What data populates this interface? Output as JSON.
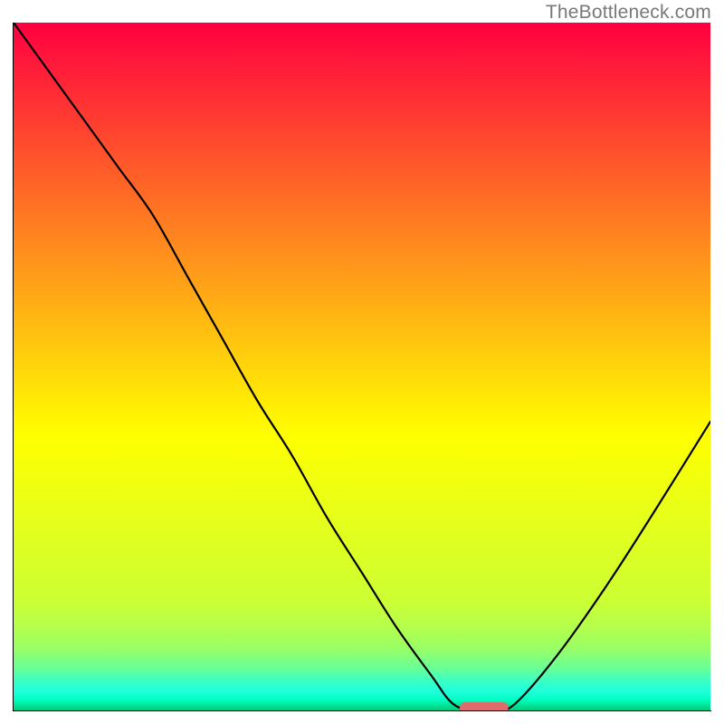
{
  "watermark": "TheBottleneck.com",
  "chart_data": {
    "type": "line",
    "title": "",
    "xlabel": "",
    "ylabel": "",
    "xlim": [
      0,
      100
    ],
    "ylim": [
      0,
      100
    ],
    "x": [
      0,
      5,
      10,
      15,
      20,
      25,
      30,
      35,
      40,
      45,
      50,
      55,
      60,
      63,
      66,
      69,
      72,
      78,
      85,
      92,
      100
    ],
    "y": [
      100,
      93,
      86,
      79,
      72,
      63,
      54,
      45,
      37,
      28,
      20,
      12,
      5,
      1,
      0,
      0,
      1,
      8,
      18,
      29,
      42
    ],
    "marker": {
      "x_range": [
        64,
        71
      ],
      "y": 0,
      "color": "#e06666"
    },
    "gradient_stops": [
      {
        "pos": 0.0,
        "color": "#ff0040"
      },
      {
        "pos": 0.5,
        "color": "#ffd500"
      },
      {
        "pos": 0.75,
        "color": "#f5ff1a"
      },
      {
        "pos": 0.92,
        "color": "#99ff66"
      },
      {
        "pos": 1.0,
        "color": "#00cc7a"
      }
    ]
  }
}
